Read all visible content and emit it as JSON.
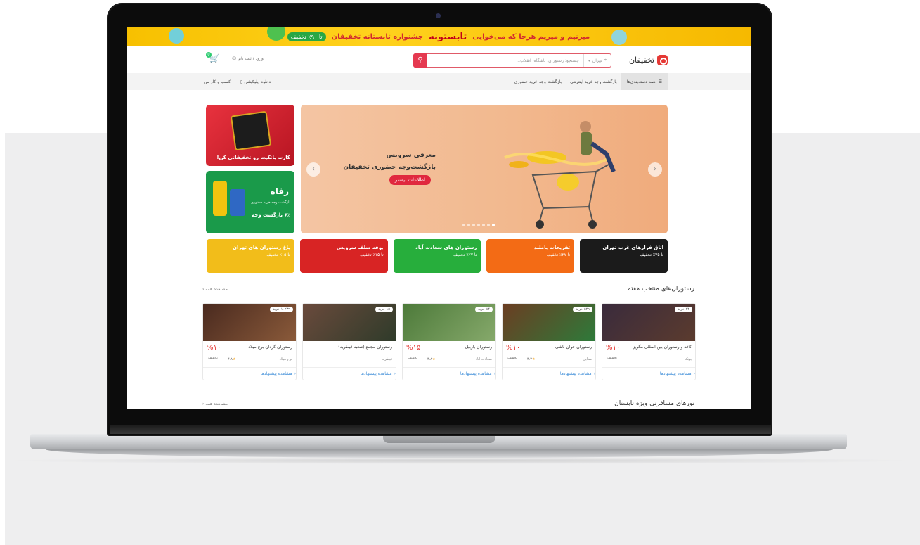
{
  "banner": {
    "line1": "میزنیم و میریم هرجا که می‌خوایی",
    "highlight": "تابستونه",
    "line2": "جشنواره تابستانه تخفیفان",
    "badge": "تا ۹۰٪ تخفیف"
  },
  "header": {
    "brand": "تخفیفان",
    "city": "تهران",
    "search_placeholder": "جستجو: رستوران، باشگاه، انقلاب...",
    "login": "ورود / ثبت نام",
    "cart_count": "0"
  },
  "nav": {
    "all_categories": "همه دسته‌بندی‌ها",
    "items": [
      "بازگشت وجه خرید اینترنتی",
      "بازگشت وجه خرید حضوری"
    ],
    "business": "کسب و کار من",
    "app": "دانلود اپلیکیشن"
  },
  "hero": {
    "heading_1": "معرفی سرویس",
    "heading_2": "بازگشت‌وجه حضوری تخفیفان",
    "cta": "اطلاعات بیشتر",
    "prev": "‹",
    "next": "›"
  },
  "side_cards": [
    {
      "label": "کارت بانکیت رو تخفیفانی کن!"
    },
    {
      "brand": "رفاه",
      "sub": "بازگشت وجه خرید حضوری",
      "label": "۶٪ بازگشت وجه"
    }
  ],
  "promos": [
    {
      "title": "اتاق فرارهای غرب تهران",
      "sub": "تا ۳۵٪ تخفیف",
      "color": "#1b1b1b"
    },
    {
      "title": "تفریحات باملند",
      "sub": "تا ۲۷٪ تخفیف",
      "color": "#f36b15"
    },
    {
      "title": "رستوران های سعادت آباد",
      "sub": "تا ۲۷٪ تخفیف",
      "color": "#27ae3c"
    },
    {
      "title": "بوفه سلف سرویس",
      "sub": "تا ۱۵٪ تخفیف",
      "color": "#d82424"
    },
    {
      "title": "باغ رستوران های تهران",
      "sub": "تا ۱۵٪ تخفیف",
      "color": "#f2bd1a"
    }
  ],
  "section1": {
    "title": "رستوران‌های منتخب هفته",
    "more": "مشاهده همه"
  },
  "cards": [
    {
      "buy": "۲۳ خرید",
      "name": "کافه و رستوران بین المللی مگریز",
      "discount": "%۱۰",
      "dlabel": "تخفیف",
      "meta": "پونک",
      "rating": "",
      "foot": "مشاهده پیشنهادها",
      "c1": "#3a2b3c",
      "c2": "#5b3b2e"
    },
    {
      "buy": "۵۲۹ خرید",
      "name": "رستوران خوان باشی",
      "discount": "%۱۰",
      "dlabel": "تخفیف",
      "meta": "سنایی",
      "rating": "۴.۳",
      "foot": "مشاهده پیشنهادها",
      "c1": "#6b3d22",
      "c2": "#2e7a3a"
    },
    {
      "buy": "۸۴ خرید",
      "name": "رستوران باربیل",
      "discount": "%۱۵",
      "dlabel": "تخفیف",
      "meta": "سعادت آباد",
      "rating": "۴.۸",
      "foot": "مشاهده پیشنهادها",
      "c1": "#4d7a3a",
      "c2": "#86a96b"
    },
    {
      "buy": "۱۵ خرید",
      "name": "رستوران مجمع (شعبه قیطریه)",
      "discount": "",
      "dlabel": "",
      "meta": "قیطریه",
      "rating": "",
      "foot": "مشاهده پیشنهادها",
      "c1": "#6a4a3c",
      "c2": "#2f3b2a"
    },
    {
      "buy": "۱۰۲۳۹ خرید",
      "name": "رستوران گردان برج میلاد",
      "discount": "%۱۰",
      "dlabel": "تخفیف",
      "meta": "برج میلاد",
      "rating": "۴.۸",
      "foot": "مشاهده پیشنهادها",
      "c1": "#4a2a1f",
      "c2": "#8a5a3a"
    }
  ],
  "section2": {
    "title": "تورهای مسافرتی ویژه تابستان",
    "more": "مشاهده همه"
  }
}
